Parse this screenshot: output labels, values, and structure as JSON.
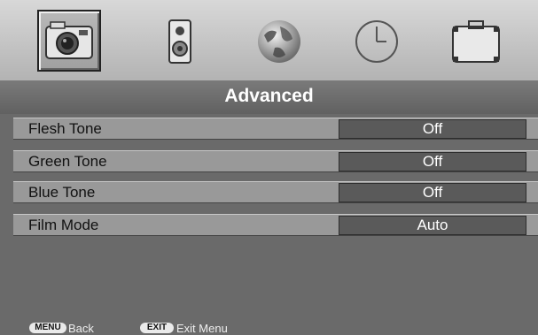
{
  "icons": [
    "camera-icon",
    "speaker-icon",
    "globe-icon",
    "clock-icon",
    "briefcase-icon"
  ],
  "header": {
    "title": "Advanced"
  },
  "settings": [
    {
      "label": "Flesh Tone",
      "value": "Off"
    },
    {
      "label": "Green Tone",
      "value": "Off"
    },
    {
      "label": "Blue Tone",
      "value": "Off"
    },
    {
      "label": "Film Mode",
      "value": "Auto"
    }
  ],
  "footer": {
    "menu_key": "MENU",
    "menu_action": "Back",
    "exit_key": "EXIT",
    "exit_action": "Exit Menu"
  }
}
